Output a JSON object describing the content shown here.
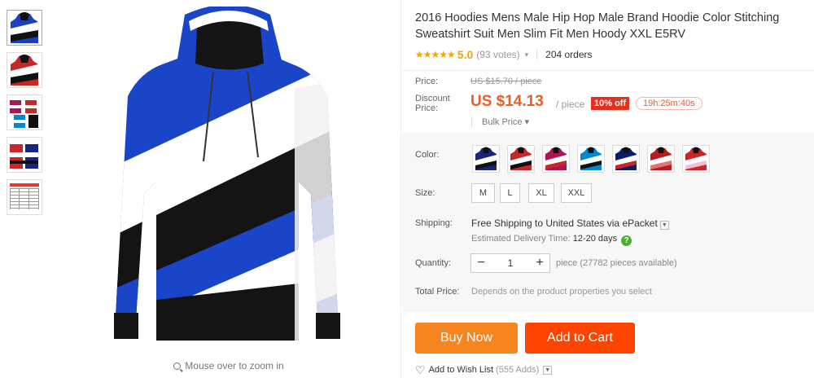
{
  "product": {
    "title": "2016 Hoodies Mens Male Hip Hop Male Brand Hoodie Color Stitching Sweatshirt Suit Men Slim Fit Men Hoody XXL E5RV",
    "stars": "★★★★★",
    "rating": "5.0",
    "votes": "(93 votes)",
    "orders": "204 orders"
  },
  "gallery": {
    "zoom_hint": "Mouse over to zoom in",
    "thumbnail_count": 5
  },
  "price": {
    "price_label": "Price:",
    "original": "US $15.70 / piece",
    "discount_label": "Discount Price:",
    "current": "US $14.13",
    "per_unit": "/ piece",
    "discount_badge": "10% off",
    "countdown": "19h:25m:40s",
    "bulk_label": "Bulk Price ▾"
  },
  "options": {
    "color_label": "Color:",
    "colors": [
      {
        "primary": "#1a237e",
        "secondary": "#ffffff",
        "tertiary": "#111111"
      },
      {
        "primary": "#c62828",
        "secondary": "#ffffff",
        "tertiary": "#111111"
      },
      {
        "primary": "#ad1457",
        "secondary": "#ffffff",
        "tertiary": "#c62828"
      },
      {
        "primary": "#0288d1",
        "secondary": "#ffffff",
        "tertiary": "#111111"
      },
      {
        "primary": "#0d1b6b",
        "secondary": "#ffffff",
        "tertiary": "#c62828"
      },
      {
        "primary": "#b71c1c",
        "secondary": "#ffffff",
        "tertiary": "#e57373"
      },
      {
        "primary": "#c62828",
        "secondary": "#ffffff",
        "tertiary": "#f8bbd0"
      }
    ],
    "size_label": "Size:",
    "sizes": [
      "M",
      "L",
      "XL",
      "XXL"
    ]
  },
  "shipping": {
    "label": "Shipping:",
    "method": "Free Shipping to United States via ePacket",
    "estimate_label": "Estimated Delivery Time:",
    "estimate_days": "12-20 days",
    "help": "?"
  },
  "quantity": {
    "label": "Quantity:",
    "minus": "−",
    "value": "1",
    "plus": "+",
    "available": "piece (27782 pieces available)"
  },
  "total": {
    "label": "Total Price:",
    "note": "Depends on the product properties you select"
  },
  "actions": {
    "buy_now": "Buy Now",
    "add_to_cart": "Add to Cart",
    "wishlist": "Add to Wish List",
    "wishlist_adds": "(555 Adds)"
  },
  "colors": {
    "accent_orange": "#f05a28",
    "buy_button": "#f6841f",
    "cart_button": "#ff4400",
    "badge_red": "#e5301e",
    "star_gold": "#f7a200"
  }
}
